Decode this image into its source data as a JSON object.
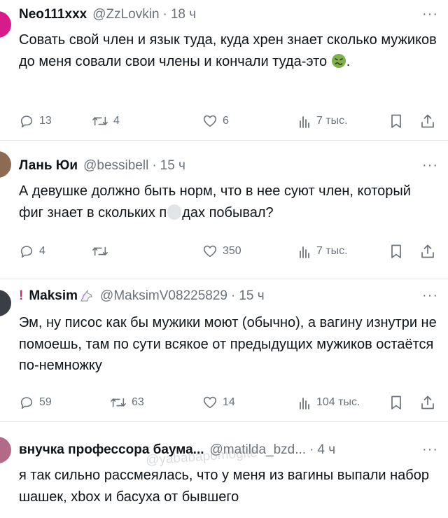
{
  "tweets": [
    {
      "name": "Neo111xxx",
      "handle": "@ZzLovkin",
      "time": "18 ч",
      "text_before": "Совать свой член и язык туда, куда хрен знает сколько мужиков до меня совали свои члены и кончали туда-это",
      "text_after": ".",
      "replies": "13",
      "reposts": "4",
      "likes": "6",
      "views": "7 тыс."
    },
    {
      "name": "Лань Юи",
      "handle": "@bessibell",
      "time": "15 ч",
      "text_before": "А девушке должно быть норм, что в нее суют член, который фиг знает в скольких п",
      "text_after": "дах побывал?",
      "replies": "4",
      "reposts": "",
      "likes": "350",
      "views": "7 тыс."
    },
    {
      "warn": "!",
      "name": "Maksim",
      "handle": "@MaksimV08225829",
      "time": "15 ч",
      "text": "Эм, ну писос как бы мужики моют (обычно), а вагину изнутри не помоешь, там по сути всякое от предыдущих мужиков остаётся по-немножку",
      "replies": "59",
      "reposts": "63",
      "likes": "14",
      "views": "104 тыс."
    },
    {
      "name": "внучка профессора баума...",
      "handle": "@matilda_bzd...",
      "time": "4 ч",
      "text": "я так сильно рассмеялась, что у меня из вагины выпали набор шашек, xbox и басуха от бывшего"
    }
  ],
  "more_label": "···",
  "dot": "·",
  "watermark": "@yababapomogite",
  "icons": [
    "reply-icon",
    "repost-icon",
    "like-icon",
    "views-icon",
    "bookmark-icon",
    "share-icon",
    "nauseated-emoji-icon",
    "unicorn-emoji-icon"
  ],
  "colors": {
    "text": "#0f1419",
    "muted": "#6b7279",
    "warn": "#e0245e",
    "divider": "#e3e6e8"
  }
}
